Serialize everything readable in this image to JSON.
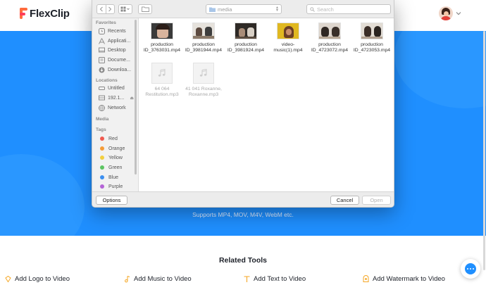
{
  "brand": {
    "name": "FlexClip"
  },
  "hero": {
    "caption": "Supports MP4, MOV, M4V, WebM etc."
  },
  "related": {
    "title": "Related Tools",
    "tools": [
      {
        "label": "Add Logo to Video",
        "icon": "logo-icon"
      },
      {
        "label": "Add Music to Video",
        "icon": "music-note-icon"
      },
      {
        "label": "Add Text to Video",
        "icon": "text-icon"
      },
      {
        "label": "Add Watermark to Video",
        "icon": "watermark-icon"
      }
    ]
  },
  "colors": {
    "hero": "#1f8fff",
    "accent": "#ff6b3d",
    "dialog_bar": "#ececec"
  },
  "dialog": {
    "path": "media",
    "search_placeholder": "Search",
    "sidebar": {
      "favorites_label": "Favorites",
      "favorites": [
        {
          "label": "Recents",
          "icon": "clock-icon"
        },
        {
          "label": "Applicati...",
          "icon": "applications-icon"
        },
        {
          "label": "Desktop",
          "icon": "desktop-icon"
        },
        {
          "label": "Docume...",
          "icon": "document-icon"
        },
        {
          "label": "Downloa...",
          "icon": "download-icon"
        }
      ],
      "locations_label": "Locations",
      "locations": [
        {
          "label": "Untitled",
          "icon": "drive-icon"
        },
        {
          "label": "192.1...",
          "icon": "server-icon"
        },
        {
          "label": "Network",
          "icon": "globe-icon"
        }
      ],
      "media_label": "Media",
      "tags_label": "Tags",
      "tags": [
        {
          "label": "Red",
          "color": "#f05a50"
        },
        {
          "label": "Orange",
          "color": "#f59c38"
        },
        {
          "label": "Yellow",
          "color": "#f2cf3f"
        },
        {
          "label": "Green",
          "color": "#5cc462"
        },
        {
          "label": "Blue",
          "color": "#3c8ff0"
        },
        {
          "label": "Purple",
          "color": "#b463d6"
        }
      ]
    },
    "files": [
      {
        "name": "production\nID_3763031.mp4",
        "kind": "video"
      },
      {
        "name": "production\nID_3981944.mp4",
        "kind": "video"
      },
      {
        "name": "production\nID_3981924.mp4",
        "kind": "video"
      },
      {
        "name": "video-\nmusic(1).mp4",
        "kind": "video"
      },
      {
        "name": "production\nID_4723072.mp4",
        "kind": "video"
      },
      {
        "name": "production\nID_4723053.mp4",
        "kind": "video"
      },
      {
        "name": "64 064\nRestitution.mp3",
        "kind": "audio"
      },
      {
        "name": "41 041 Roxanne,\nRoxanne.mp3",
        "kind": "audio"
      }
    ],
    "options_label": "Options",
    "cancel_label": "Cancel",
    "open_label": "Open"
  }
}
